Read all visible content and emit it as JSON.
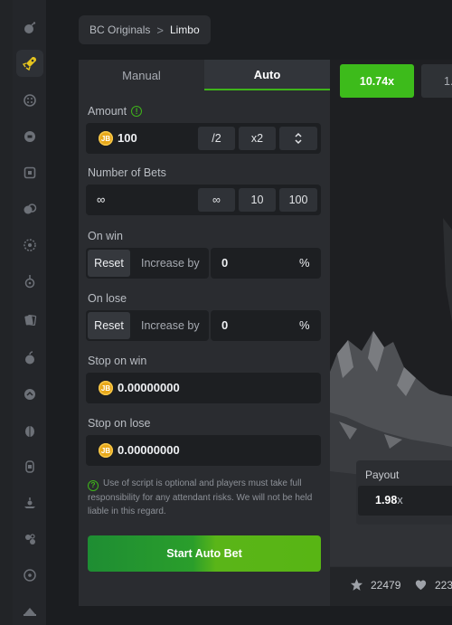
{
  "breadcrumb": {
    "parent": "BC Originals",
    "separator": ">",
    "current": "Limbo"
  },
  "tabs": [
    {
      "label": "Manual",
      "active": false
    },
    {
      "label": "Auto",
      "active": true
    }
  ],
  "amount": {
    "label": "Amount",
    "info": "!",
    "currency_icon": "bcd-coin-icon",
    "coin_text": "JB",
    "value": "100",
    "half_label": "/2",
    "double_label": "x2",
    "stepper_icon": "up-down-chevron-icon"
  },
  "bets": {
    "label": "Number of Bets",
    "value": "∞",
    "options": [
      "∞",
      "10",
      "100"
    ]
  },
  "on_win": {
    "label": "On win",
    "reset_label": "Reset",
    "increase_label": "Increase by",
    "value": "0",
    "unit": "%"
  },
  "on_lose": {
    "label": "On lose",
    "reset_label": "Reset",
    "increase_label": "Increase by",
    "value": "0",
    "unit": "%"
  },
  "stop_on_win": {
    "label": "Stop on win",
    "coin_text": "JB",
    "value": "0.00000000"
  },
  "stop_on_lose": {
    "label": "Stop on lose",
    "coin_text": "JB",
    "value": "0.00000000"
  },
  "disclaimer": {
    "icon": "?",
    "text": "Use of script is optional and players must take full responsibility for any attendant risks. We will not be held liable in this regard."
  },
  "start_button": {
    "label": "Start Auto Bet"
  },
  "history": [
    {
      "value": "10.74x",
      "color": "#3dbb1b"
    },
    {
      "value": "1.",
      "color": "#2f3236"
    }
  ],
  "payout": {
    "label": "Payout",
    "value": "1.98",
    "suffix": "x"
  },
  "stats": {
    "stars": "22479",
    "likes": "223"
  },
  "colors": {
    "accent_green": "#3fb41a",
    "panel": "#2a2c30",
    "field": "#1d1f22",
    "coin": "#e8a81a"
  },
  "sidebar_icons": [
    "bomb-icon",
    "rocket-icon",
    "dice-icon",
    "chip-icon",
    "square-icon",
    "coins-icon",
    "wheel-icon",
    "plinko-icon",
    "cards-icon",
    "fruit-icon",
    "hilo-icon",
    "egg-icon",
    "slot-icon",
    "tower-icon",
    "roulette-icon",
    "circle-icon",
    "hat-icon"
  ]
}
